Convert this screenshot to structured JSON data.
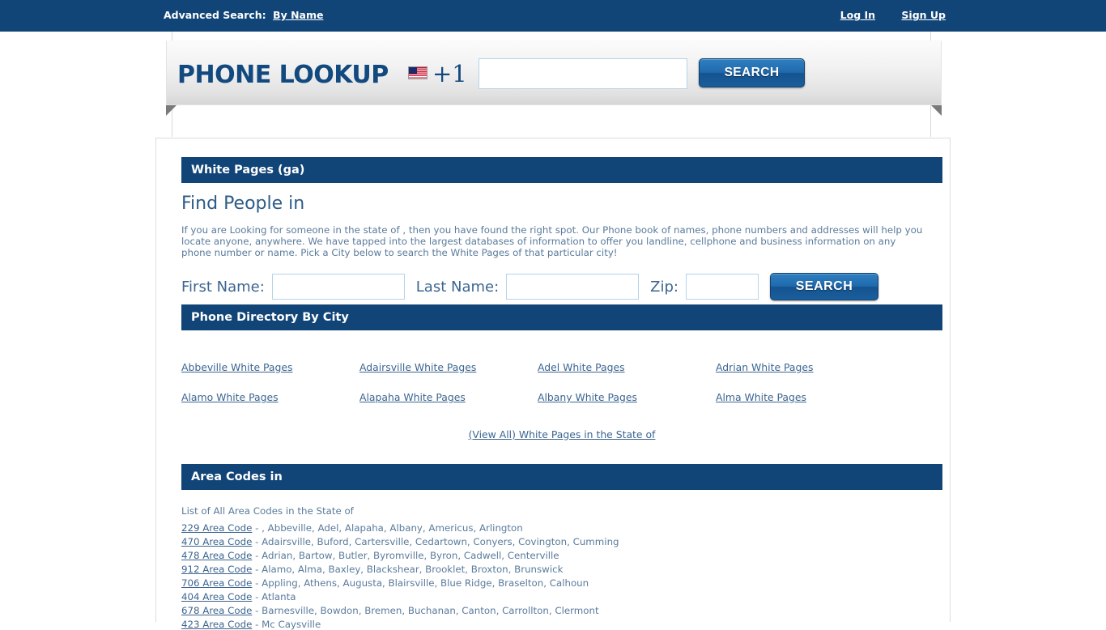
{
  "topbar": {
    "advanced_search_label": "Advanced Search:",
    "by_name_link": "By Name",
    "login_link": "Log In",
    "signup_link": "Sign Up"
  },
  "lookup": {
    "title": "PHONE LOOKUP",
    "flag_icon": "us-flag-icon",
    "country_code": "+1",
    "phone_value": "",
    "phone_placeholder": "",
    "search_label": "SEARCH"
  },
  "main": {
    "section_title": "White Pages (ga)",
    "heading": "Find People in",
    "intro": "If you are Looking for someone in the state of , then you have found the right spot. Our Phone book of names, phone numbers and addresses will help you locate anyone, anywhere. We have tapped into the largest databases of information to offer you landline, cellphone and business information on any phone number or name. Pick a City below to search the White Pages of that particular city!",
    "form": {
      "first_name_label": "First Name:",
      "first_name_value": "",
      "last_name_label": "Last Name:",
      "last_name_value": "",
      "zip_label": "Zip:",
      "zip_value": "",
      "search_label": "SEARCH"
    },
    "directory": {
      "title": "Phone Directory By City",
      "cities": [
        "Abbeville White Pages",
        "Adairsville White Pages",
        "Adel White Pages",
        "Adrian White Pages",
        "Alamo White Pages",
        "Alapaha White Pages",
        "Albany White Pages",
        "Alma White Pages"
      ],
      "view_all": "(View All) White Pages in the State of"
    },
    "area_codes": {
      "title": "Area Codes in",
      "lead": "List of All Area Codes in the State of",
      "rows": [
        {
          "code": "229 Area Code",
          "cities": "- , Abbeville, Adel, Alapaha, Albany, Americus, Arlington"
        },
        {
          "code": "470 Area Code",
          "cities": "- Adairsville, Buford, Cartersville, Cedartown, Conyers, Covington, Cumming"
        },
        {
          "code": "478 Area Code",
          "cities": "- Adrian, Bartow, Butler, Byromville, Byron, Cadwell, Centerville"
        },
        {
          "code": "912 Area Code",
          "cities": "- Alamo, Alma, Baxley, Blackshear, Brooklet, Broxton, Brunswick"
        },
        {
          "code": "706 Area Code",
          "cities": "- Appling, Athens, Augusta, Blairsville, Blue Ridge, Braselton, Calhoun"
        },
        {
          "code": "404 Area Code",
          "cities": "- Atlanta"
        },
        {
          "code": "678 Area Code",
          "cities": "- Barnesville, Bowdon, Bremen, Buchanan, Canton, Carrollton, Clermont"
        },
        {
          "code": "423 Area Code",
          "cities": "- Mc Caysville"
        }
      ]
    }
  },
  "colors": {
    "navy": "#114477",
    "link": "#3c6590",
    "body_text": "#5a7b9c",
    "button_blue": "#1f6aad"
  }
}
